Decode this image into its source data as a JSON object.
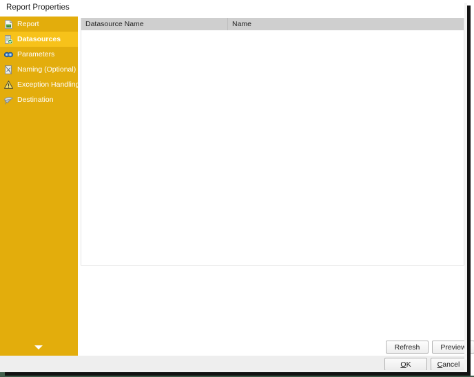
{
  "window": {
    "title": "Report Properties"
  },
  "sidebar": {
    "items": [
      {
        "label": "Report",
        "icon": "report-document-icon",
        "selected": false
      },
      {
        "label": "Datasources",
        "icon": "database-check-icon",
        "selected": true
      },
      {
        "label": "Parameters",
        "icon": "parameters-rings-icon",
        "selected": false
      },
      {
        "label": "Naming (Optional)",
        "icon": "naming-tag-icon",
        "selected": false
      },
      {
        "label": "Exception Handling",
        "icon": "warning-triangle-icon",
        "selected": false
      },
      {
        "label": "Destination",
        "icon": "destination-send-icon",
        "selected": false
      }
    ],
    "expander_icon": "chevron-down-icon",
    "background_color": "#e3ad0c",
    "selected_color": "#f7c21a"
  },
  "main": {
    "list": {
      "columns": [
        {
          "key": "datasource_name",
          "label": "Datasource Name"
        },
        {
          "key": "name",
          "label": "Name"
        }
      ],
      "rows": []
    },
    "buttons": {
      "refresh": "Refresh",
      "preview": "Preview"
    }
  },
  "footer": {
    "ok": {
      "prefix": "",
      "accel": "O",
      "suffix": "K"
    },
    "cancel": {
      "prefix": "",
      "accel": "C",
      "suffix": "ancel"
    }
  }
}
